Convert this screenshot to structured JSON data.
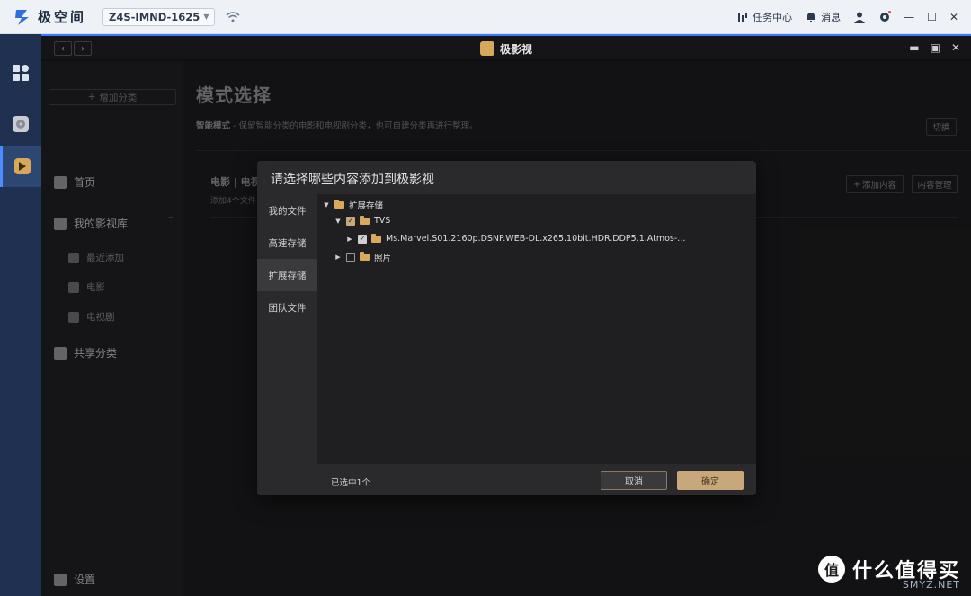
{
  "os": {
    "brand": "极空间",
    "device": "Z4S-IMND-1625",
    "task_center": "任务中心",
    "messages": "消息"
  },
  "window": {
    "title": "极影视"
  },
  "sidebar": {
    "add_category": "增加分类",
    "home": "首页",
    "my_library": "我的影视库",
    "recent": "最近添加",
    "movies": "电影",
    "tv": "电视剧",
    "shared": "共享分类",
    "settings": "设置"
  },
  "main": {
    "title": "模式选择",
    "mode_label": "智能模式",
    "mode_desc": " - 保留智能分类的电影和电视剧分类，也可自建分类再进行整理。",
    "switch": "切换",
    "lib_title": "电影 | 电视",
    "lib_sub": "添加4个文件",
    "add_content": "添加内容",
    "manage_content": "内容管理"
  },
  "modal": {
    "title": "请选择哪些内容添加到极影视",
    "tabs": [
      "我的文件",
      "高速存储",
      "扩展存储",
      "团队文件"
    ],
    "active_tab": 2,
    "tree": {
      "root": "扩展存储",
      "tvs": "TVS",
      "marvel": "Ms.Marvel.S01.2160p.DSNP.WEB-DL.x265.10bit.HDR.DDP5.1.Atmos-...",
      "photos": "照片"
    },
    "selected_count": "已选中1个",
    "cancel": "取消",
    "ok": "确定"
  },
  "watermark": {
    "logo": "值",
    "text": "什么值得买",
    "sub": "SMYZ.NET"
  },
  "colors": {
    "accent_blue": "#3b7bff",
    "gold": "#c8a77a",
    "dock_bg": "#1f3050"
  }
}
